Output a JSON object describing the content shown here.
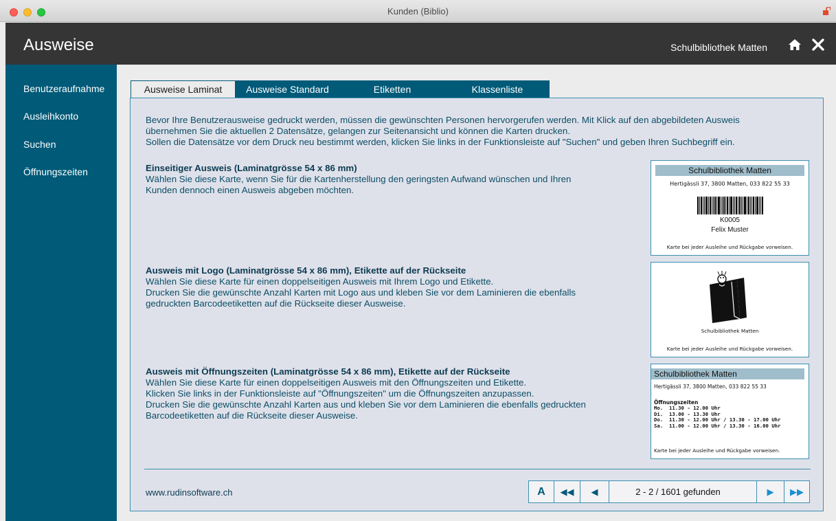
{
  "window": {
    "title": "Kunden (Biblio)"
  },
  "header": {
    "title": "Ausweise",
    "library": "Schulbibliothek Matten"
  },
  "sidebar": {
    "items": [
      {
        "label": "Benutzeraufnahme"
      },
      {
        "label": "Ausleihkonto"
      },
      {
        "label": "Suchen"
      },
      {
        "label": "Öffnungszeiten"
      }
    ]
  },
  "tabs": [
    {
      "label": "Ausweise Laminat",
      "active": true
    },
    {
      "label": "Ausweise Standard",
      "active": false
    },
    {
      "label": "Etiketten",
      "active": false
    },
    {
      "label": "Klassenliste",
      "active": false
    }
  ],
  "intro": [
    "Bevor Ihre Benutzerausweise gedruckt werden, müssen die gewünschten Personen hervorgerufen werden. Mit Klick auf den abgebildeten Ausweis",
    "übernehmen Sie die aktuellen 2 Datensätze, gelangen zur Seitenansicht und können die Karten drucken.",
    "Sollen die Datensätze vor dem Druck neu bestimmt werden, klicken Sie links in der Funktionsleiste auf \"Suchen\" und geben Ihren Suchbegriff ein."
  ],
  "sections": [
    {
      "title": "Einseitiger Ausweis (Laminatgrösse 54 x 86 mm)",
      "lines": [
        "Wählen Sie diese Karte, wenn Sie für die Kartenherstellung den geringsten Aufwand wünschen und Ihren",
        "Kunden dennoch einen Ausweis abgeben möchten."
      ]
    },
    {
      "title": "Ausweis mit Logo (Laminatgrösse 54 x 86 mm), Etikette auf der Rückseite",
      "lines": [
        "Wählen Sie diese Karte für einen doppelseitigen Ausweis mit Ihrem Logo und Etikette.",
        "Drucken Sie die gewünschte Anzahl Karten mit Logo aus und kleben Sie vor dem Laminieren die ebenfalls",
        "gedruckten Barcodeetiketten auf die Rückseite dieser Ausweise."
      ]
    },
    {
      "title": "Ausweis mit Öffnungszeiten (Laminatgrösse 54 x 86 mm), Etikette auf der Rückseite",
      "lines": [
        "Wählen Sie diese Karte für einen doppelseitigen Ausweis mit den Öffnungszeiten und Etikette.",
        "Klicken Sie links in der Funktionsleiste auf \"Öffnungszeiten\" um die Öffnungszeiten anzupassen.",
        "Drucken Sie die gewünschte Anzahl Karten aus und kleben Sie vor dem Laminieren die ebenfalls gedruckten",
        "Barcodeetiketten auf die Rückseite dieser Ausweise."
      ]
    }
  ],
  "cards": {
    "card1": {
      "library": "Schulbibliothek Matten",
      "address": "Hertigässli 37, 3800 Matten, 033 822 55 33",
      "id": "K0005",
      "name": "Felix Muster",
      "footer": "Karte bei jeder Ausleihe und Rückgabe vorweisen."
    },
    "card2": {
      "library": "Schulbibliothek Matten",
      "footer": "Karte bei jeder Ausleihe und Rückgabe vorweisen."
    },
    "card3": {
      "library": "Schulbibliothek Matten",
      "address": "Hertigässli 37, 3800 Matten, 033 822 55 33",
      "hours_title": "Öffnungszeiten",
      "hours": [
        "Mo.  11.30 - 12.00 Uhr",
        "Di.  13.00 - 13.30 Uhr",
        "Do.  11.30 - 12.00 Uhr / 13.30 - 17.00 Uhr",
        "Sa.  11.00 - 12.00 Uhr / 13.30 - 16.00 Uhr"
      ],
      "footer": "Karte bei jeder Ausleihe und Rückgabe vorweisen."
    }
  },
  "footer": {
    "url": "www.rudinsoftware.ch",
    "pager": {
      "a_label": "A",
      "first": "◀◀",
      "prev": "◀",
      "info": "2 - 2 / 1601 gefunden",
      "next": "▶",
      "last": "▶▶"
    }
  },
  "colors": {
    "sidebar": "#005a78",
    "header": "#353535",
    "accent": "#3c8fb0",
    "card_head": "#9fbdcb"
  }
}
